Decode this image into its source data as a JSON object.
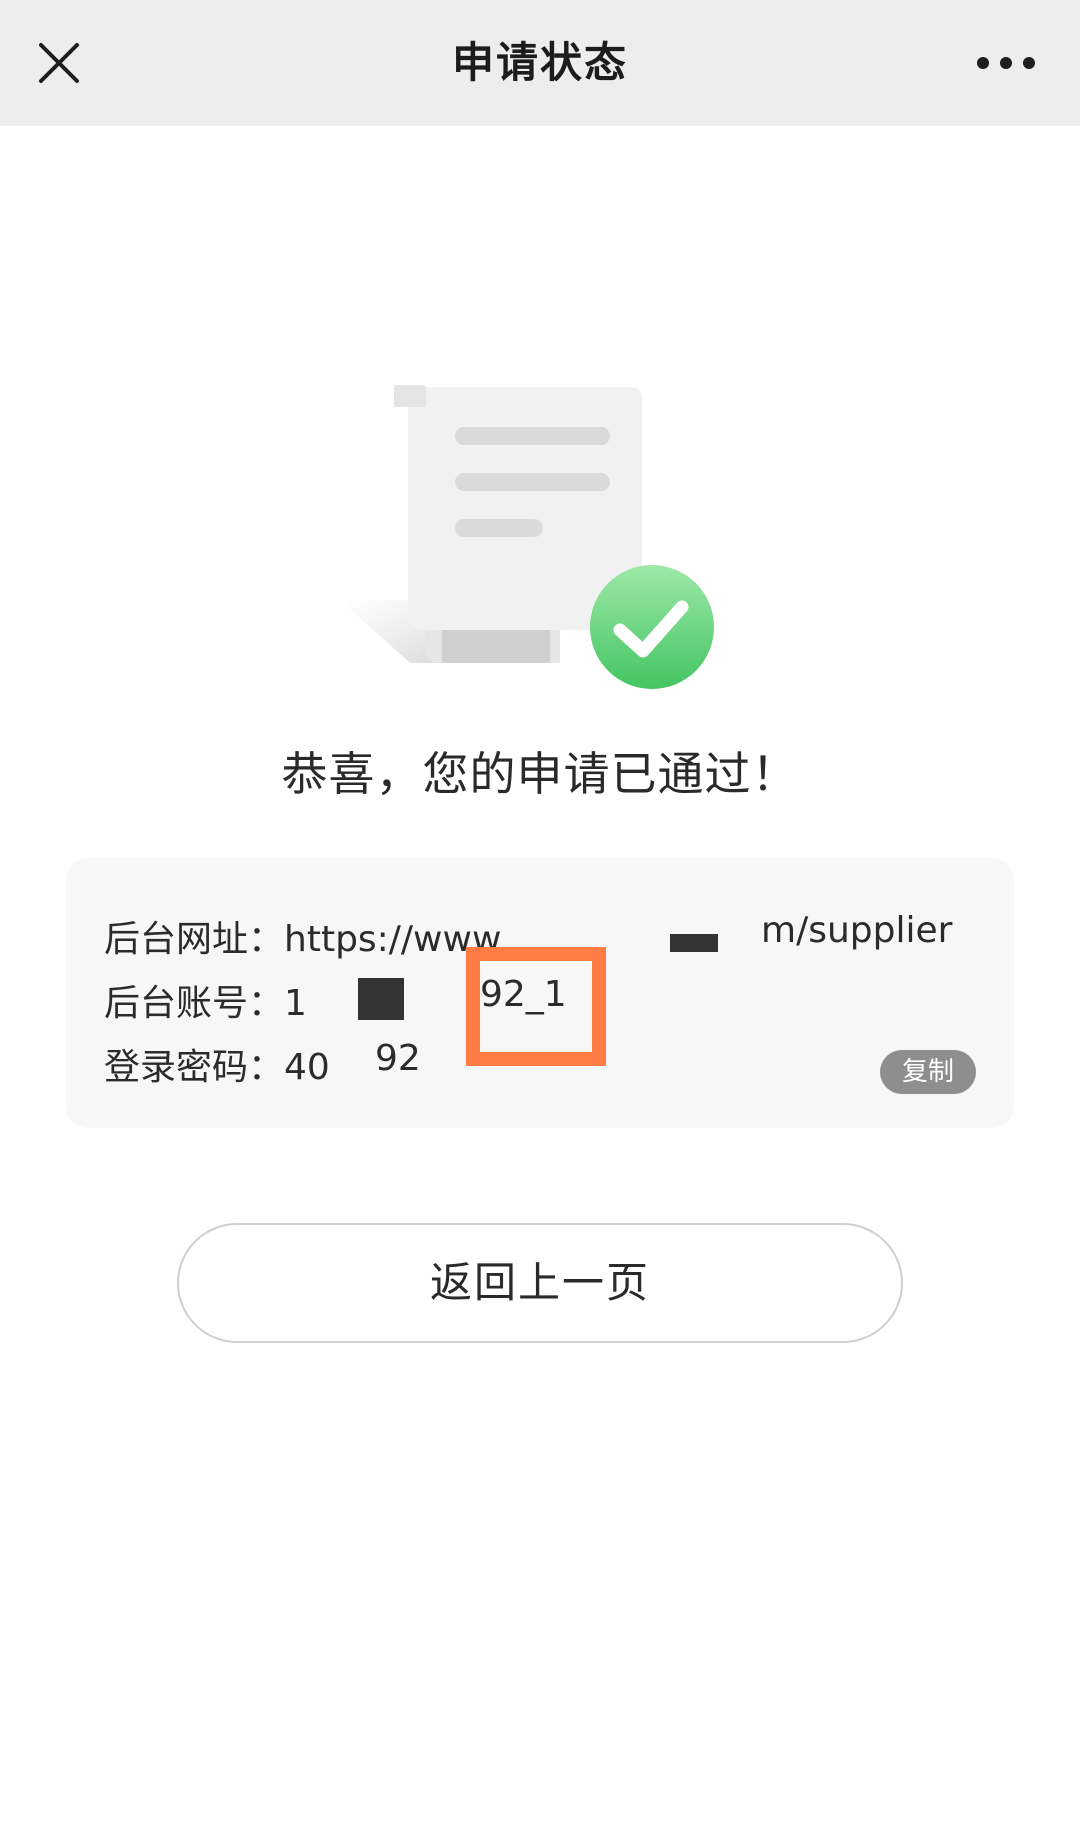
{
  "navbar": {
    "title": "申请状态",
    "close_icon": "close-icon",
    "more_icon": "more-horizontal-icon"
  },
  "illustration": {
    "document_icon": "receipt-document-icon",
    "check_icon": "success-check-icon",
    "check_color": "#5ed07a"
  },
  "main": {
    "success_title": "恭喜，您的申请已通过！"
  },
  "info": {
    "url_label": "后台网址：",
    "url_value_start": "https://www",
    "url_value_end": "m/supplier",
    "account_label": "后台账号：",
    "account_value_start": "1",
    "account_value_end": "92_1",
    "password_label": "登录密码：",
    "password_value_start": "40",
    "password_value_end": "92",
    "copy_label": "复制"
  },
  "actions": {
    "back_label": "返回上一页"
  },
  "colors": {
    "navbar_bg": "#ededed",
    "card_bg": "#f7f7f7",
    "copy_bg": "#8e8e8e",
    "highlight": "#ff7c43"
  }
}
